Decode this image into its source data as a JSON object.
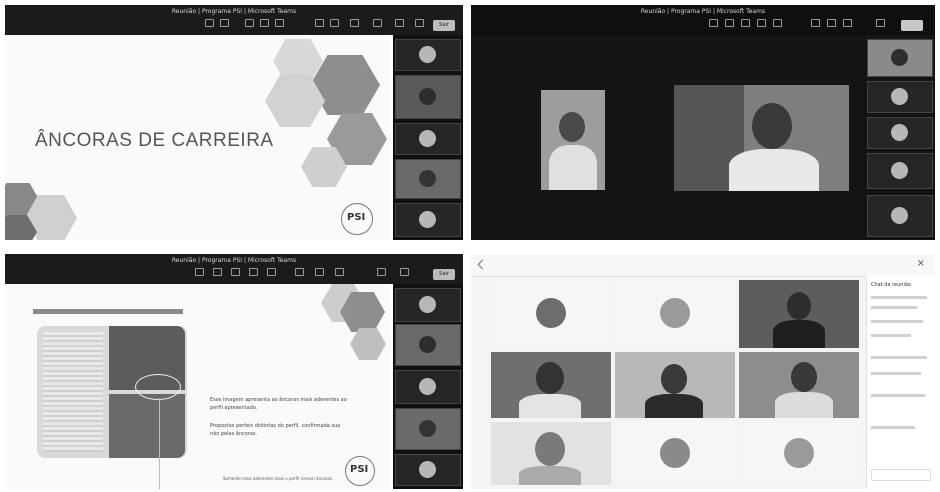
{
  "q1": {
    "window_title": "Reunião | Programa PSI | Microsoft Teams",
    "slide_title": "ÂNCORAS DE CARREIRA",
    "logo": "PSI",
    "leave": "Sair"
  },
  "q2": {
    "window_title": "Reunião | Programa PSI | Microsoft Teams"
  },
  "q3": {
    "window_title": "Reunião | Programa PSI | Microsoft Teams",
    "logo": "PSI",
    "leave": "Sair",
    "text1": "Esse imagem apresenta as âncoras mais aderentes ao perfil apresentado.",
    "text2": "Propostas perfeis distintas do perfil, confirmada sua não pelas âncoras.",
    "callout": "Somente mais aderentes mais o perfil (cesso) âncoras."
  },
  "q4": {
    "panel_title": "Chat da reunião"
  },
  "colors": {
    "hex_dark": "#7a7a7a",
    "hex_mid": "#a2a2a2",
    "hex_light": "#cfcfcf",
    "teams_bar": "#1b1b1b"
  }
}
